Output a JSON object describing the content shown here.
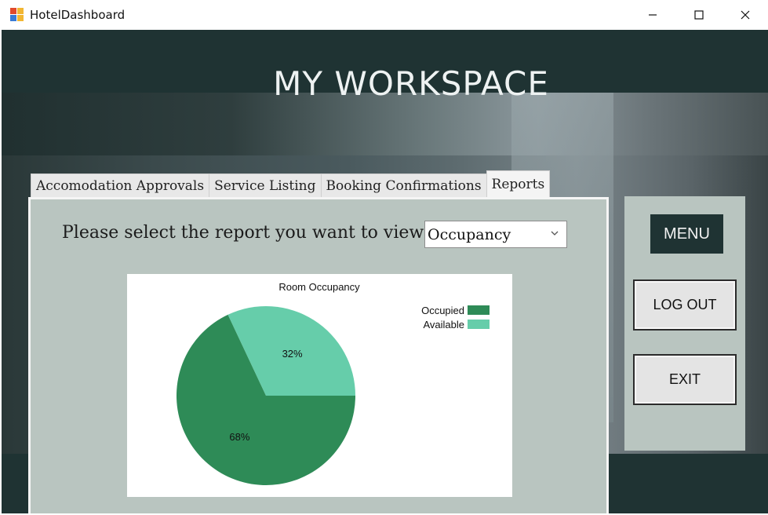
{
  "window": {
    "title": "HotelDashboard",
    "controls": {
      "minimize": "—",
      "maximize": "☐",
      "close": "✕"
    }
  },
  "header": {
    "title": "MY WORKSPACE"
  },
  "tabs": [
    {
      "label": "Accomodation Approvals",
      "active": false
    },
    {
      "label": "Service Listing",
      "active": false
    },
    {
      "label": "Booking Confirmations",
      "active": false
    },
    {
      "label": "Reports",
      "active": true
    }
  ],
  "report": {
    "prompt": "Please select the report you want to view :",
    "selected": "Occupancy"
  },
  "chart_data": {
    "type": "pie",
    "title": "Room Occupancy",
    "categories": [
      "Occupied",
      "Available"
    ],
    "values": [
      68,
      32
    ],
    "labels": [
      "68%",
      "32%"
    ],
    "colors": [
      "#2e8b57",
      "#66cdaa"
    ],
    "legend_position": "top-right"
  },
  "side_menu": {
    "menu_label": "MENU",
    "logout_label": "LOG OUT",
    "exit_label": "EXIT"
  }
}
